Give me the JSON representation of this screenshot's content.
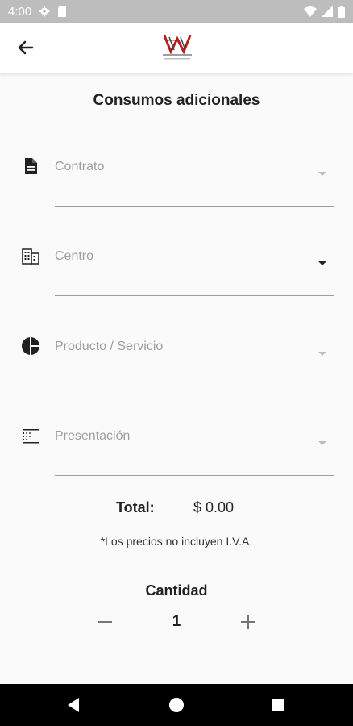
{
  "status_bar": {
    "time": "4:00"
  },
  "app_bar": {
    "back_icon": "arrow-back-icon",
    "logo": "brand-logo"
  },
  "page": {
    "title": "Consumos adicionales"
  },
  "form": {
    "fields": [
      {
        "label": "Contrato",
        "icon": "document-icon"
      },
      {
        "label": "Centro",
        "icon": "building-icon"
      },
      {
        "label": "Producto / Servicio",
        "icon": "pie-chart-icon"
      },
      {
        "label": "Presentación",
        "icon": "grid-list-icon"
      }
    ]
  },
  "total": {
    "label": "Total:",
    "value": "$ 0.00"
  },
  "note": "*Los precios no incluyen I.V.A.",
  "quantity": {
    "title": "Cantidad",
    "value": "1"
  },
  "colors": {
    "status_bar": "#bdbdbd",
    "background": "#fafafa",
    "divider": "#9e9e9e",
    "nav_bar": "#000000"
  }
}
